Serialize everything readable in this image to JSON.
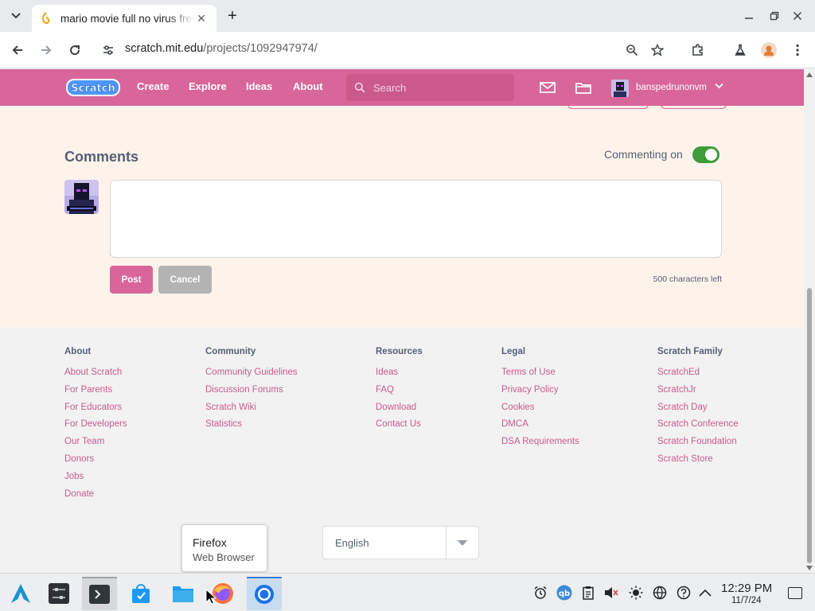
{
  "browser": {
    "tab_title": "mario movie full no virus free",
    "url_host": "scratch.mit.edu",
    "url_path": "/projects/1092947974/"
  },
  "scratch": {
    "nav": {
      "create": "Create",
      "explore": "Explore",
      "ideas": "Ideas",
      "about": "About",
      "search_placeholder": "Search",
      "username": "banspedrunonvm"
    },
    "comments": {
      "title": "Comments",
      "commenting_label": "Commenting on",
      "commenting_enabled": true,
      "textarea_value": "",
      "post": "Post",
      "cancel": "Cancel",
      "chars_left": "500 characters left"
    },
    "footer": {
      "columns": [
        {
          "heading": "About",
          "links": [
            "About Scratch",
            "For Parents",
            "For Educators",
            "For Developers",
            "Our Team",
            "Donors",
            "Jobs",
            "Donate"
          ]
        },
        {
          "heading": "Community",
          "links": [
            "Community Guidelines",
            "Discussion Forums",
            "Scratch Wiki",
            "Statistics"
          ]
        },
        {
          "heading": "Resources",
          "links": [
            "Ideas",
            "FAQ",
            "Download",
            "Contact Us"
          ]
        },
        {
          "heading": "Legal",
          "links": [
            "Terms of Use",
            "Privacy Policy",
            "Cookies",
            "DMCA",
            "DSA Requirements"
          ]
        },
        {
          "heading": "Scratch Family",
          "links": [
            "ScratchEd",
            "ScratchJr",
            "Scratch Day",
            "Scratch Conference",
            "Scratch Foundation",
            "Scratch Store"
          ]
        }
      ],
      "language": "English"
    },
    "colors": {
      "brand": "#d9669a",
      "link": "#c85b8c",
      "text": "#575e75",
      "toggle_on": "#3e9c3a"
    }
  },
  "tooltip": {
    "title": "Firefox",
    "subtitle": "Web Browser"
  },
  "taskbar": {
    "time": "12:29 PM",
    "date": "11/7/24",
    "apps": [
      "arch-launcher-icon",
      "system-settings-icon",
      "terminal-icon",
      "discover-store-icon",
      "file-manager-icon",
      "firefox-icon",
      "chrome-icon"
    ],
    "tray": [
      "alarm-clock-icon",
      "qbittorrent-icon",
      "clipboard-icon",
      "volume-muted-icon",
      "brightness-icon",
      "network-icon",
      "help-icon",
      "expand-tray-icon"
    ]
  }
}
